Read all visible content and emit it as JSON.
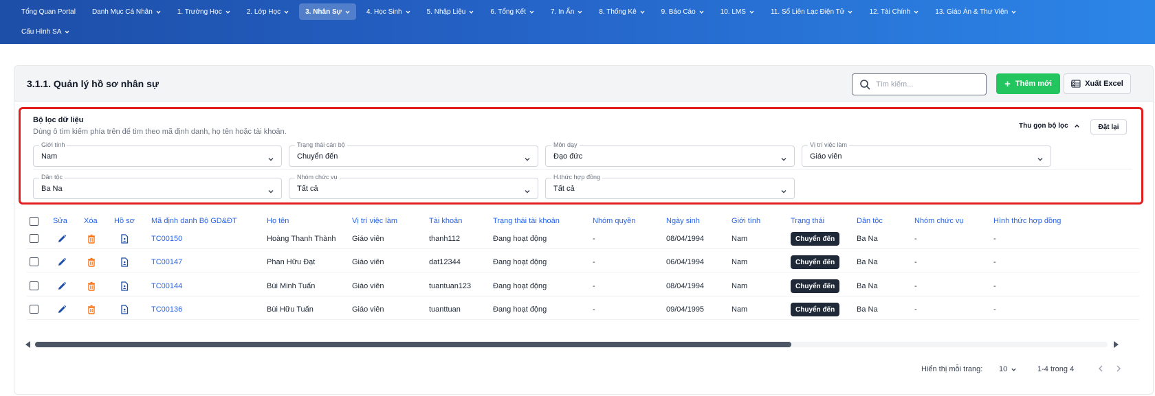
{
  "nav": {
    "row1": [
      {
        "label": "Tổng Quan Portal",
        "has_chevron": false,
        "active": false
      },
      {
        "label": "Danh Mục Cá Nhân",
        "has_chevron": true,
        "active": false
      },
      {
        "label": "1. Trường Học",
        "has_chevron": true,
        "active": false
      },
      {
        "label": "2. Lớp Học",
        "has_chevron": true,
        "active": false
      },
      {
        "label": "3. Nhân Sự",
        "has_chevron": true,
        "active": true
      },
      {
        "label": "4. Học Sinh",
        "has_chevron": true,
        "active": false
      },
      {
        "label": "5. Nhập Liệu",
        "has_chevron": true,
        "active": false
      },
      {
        "label": "6. Tổng Kết",
        "has_chevron": true,
        "active": false
      },
      {
        "label": "7. In Ấn",
        "has_chevron": true,
        "active": false
      },
      {
        "label": "8. Thống Kê",
        "has_chevron": true,
        "active": false
      },
      {
        "label": "9. Báo Cáo",
        "has_chevron": true,
        "active": false
      },
      {
        "label": "10. LMS",
        "has_chevron": true,
        "active": false
      },
      {
        "label": "11. Sổ Liên Lạc Điện Tử",
        "has_chevron": true,
        "active": false
      },
      {
        "label": "12. Tài Chính",
        "has_chevron": true,
        "active": false
      },
      {
        "label": "13. Giáo Án & Thư Viện",
        "has_chevron": true,
        "active": false
      }
    ],
    "row2": [
      {
        "label": "Cấu Hình SA",
        "has_chevron": true,
        "active": false
      }
    ]
  },
  "header": {
    "title": "3.1.1. Quản lý hồ sơ nhân sự",
    "search_placeholder": "Tìm kiếm...",
    "add_label": "Thêm mới",
    "excel_label": "Xuất Excel"
  },
  "filter": {
    "title": "Bộ lọc dữ liệu",
    "hint": "Dùng ô tìm kiếm phía trên để tìm theo mã định danh, họ tên hoặc tài khoản.",
    "collapse_label": "Thu gọn bộ lọc",
    "reset_label": "Đặt lại",
    "fields": [
      {
        "label": "Giới tính",
        "value": "Nam"
      },
      {
        "label": "Trạng thái cán bộ",
        "value": "Chuyển đến"
      },
      {
        "label": "Môn dạy",
        "value": "Đạo đức"
      },
      {
        "label": "Vị trí việc làm",
        "value": "Giáo viên"
      },
      {
        "label": "Dân tộc",
        "value": "Ba Na"
      },
      {
        "label": "Nhóm chức vụ",
        "value": "Tất cả"
      },
      {
        "label": "H.thức hợp đồng",
        "value": "Tất cả"
      }
    ]
  },
  "table": {
    "columns": [
      "Sửa",
      "Xóa",
      "Hồ sơ",
      "Mã định danh Bộ GD&ĐT",
      "Họ tên",
      "Vị trí việc làm",
      "Tài khoản",
      "Trạng thái tài khoản",
      "Nhóm quyền",
      "Ngày sinh",
      "Giới tính",
      "Trạng thái",
      "Dân tộc",
      "Nhóm chức vụ",
      "Hình thức hợp đồng"
    ],
    "rows": [
      [
        "TC00150",
        "Hoàng Thanh Thành",
        "Giáo viên",
        "thanh112",
        "Đang hoạt động",
        "-",
        "08/04/1994",
        "Nam",
        "Chuyển đến",
        "Ba Na",
        "-",
        "-"
      ],
      [
        "TC00147",
        "Phan Hữu Đạt",
        "Giáo viên",
        "dat12344",
        "Đang hoạt động",
        "-",
        "06/04/1994",
        "Nam",
        "Chuyển đến",
        "Ba Na",
        "-",
        "-"
      ],
      [
        "TC00144",
        "Bùi Minh Tuấn",
        "Giáo viên",
        "tuantuan123",
        "Đang hoạt động",
        "-",
        "08/04/1994",
        "Nam",
        "Chuyển đến",
        "Ba Na",
        "-",
        "-"
      ],
      [
        "TC00136",
        "Bùi Hữu Tuấn",
        "Giáo viên",
        "tuanttuan",
        "Đang hoạt động",
        "-",
        "09/04/1995",
        "Nam",
        "Chuyển đến",
        "Ba Na",
        "-",
        "-"
      ]
    ]
  },
  "pagination": {
    "per_page_label": "Hiển thị mỗi trang:",
    "per_page_value": "10",
    "range_text": "1-4 trong 4"
  },
  "colors": {
    "nav_gradient_start": "#1d4ea8",
    "nav_gradient_end": "#2c86e8",
    "accent_blue": "#2563eb",
    "add_green": "#22c55e",
    "delete_red": "#f97316",
    "filter_border": "#e11d1d",
    "badge_dark": "#1f2937"
  },
  "icons": {
    "edit": "pencil-icon",
    "delete": "trash-icon",
    "profile": "document-user-icon",
    "search": "search-icon",
    "excel": "excel-icon",
    "add": "plus-icon"
  }
}
